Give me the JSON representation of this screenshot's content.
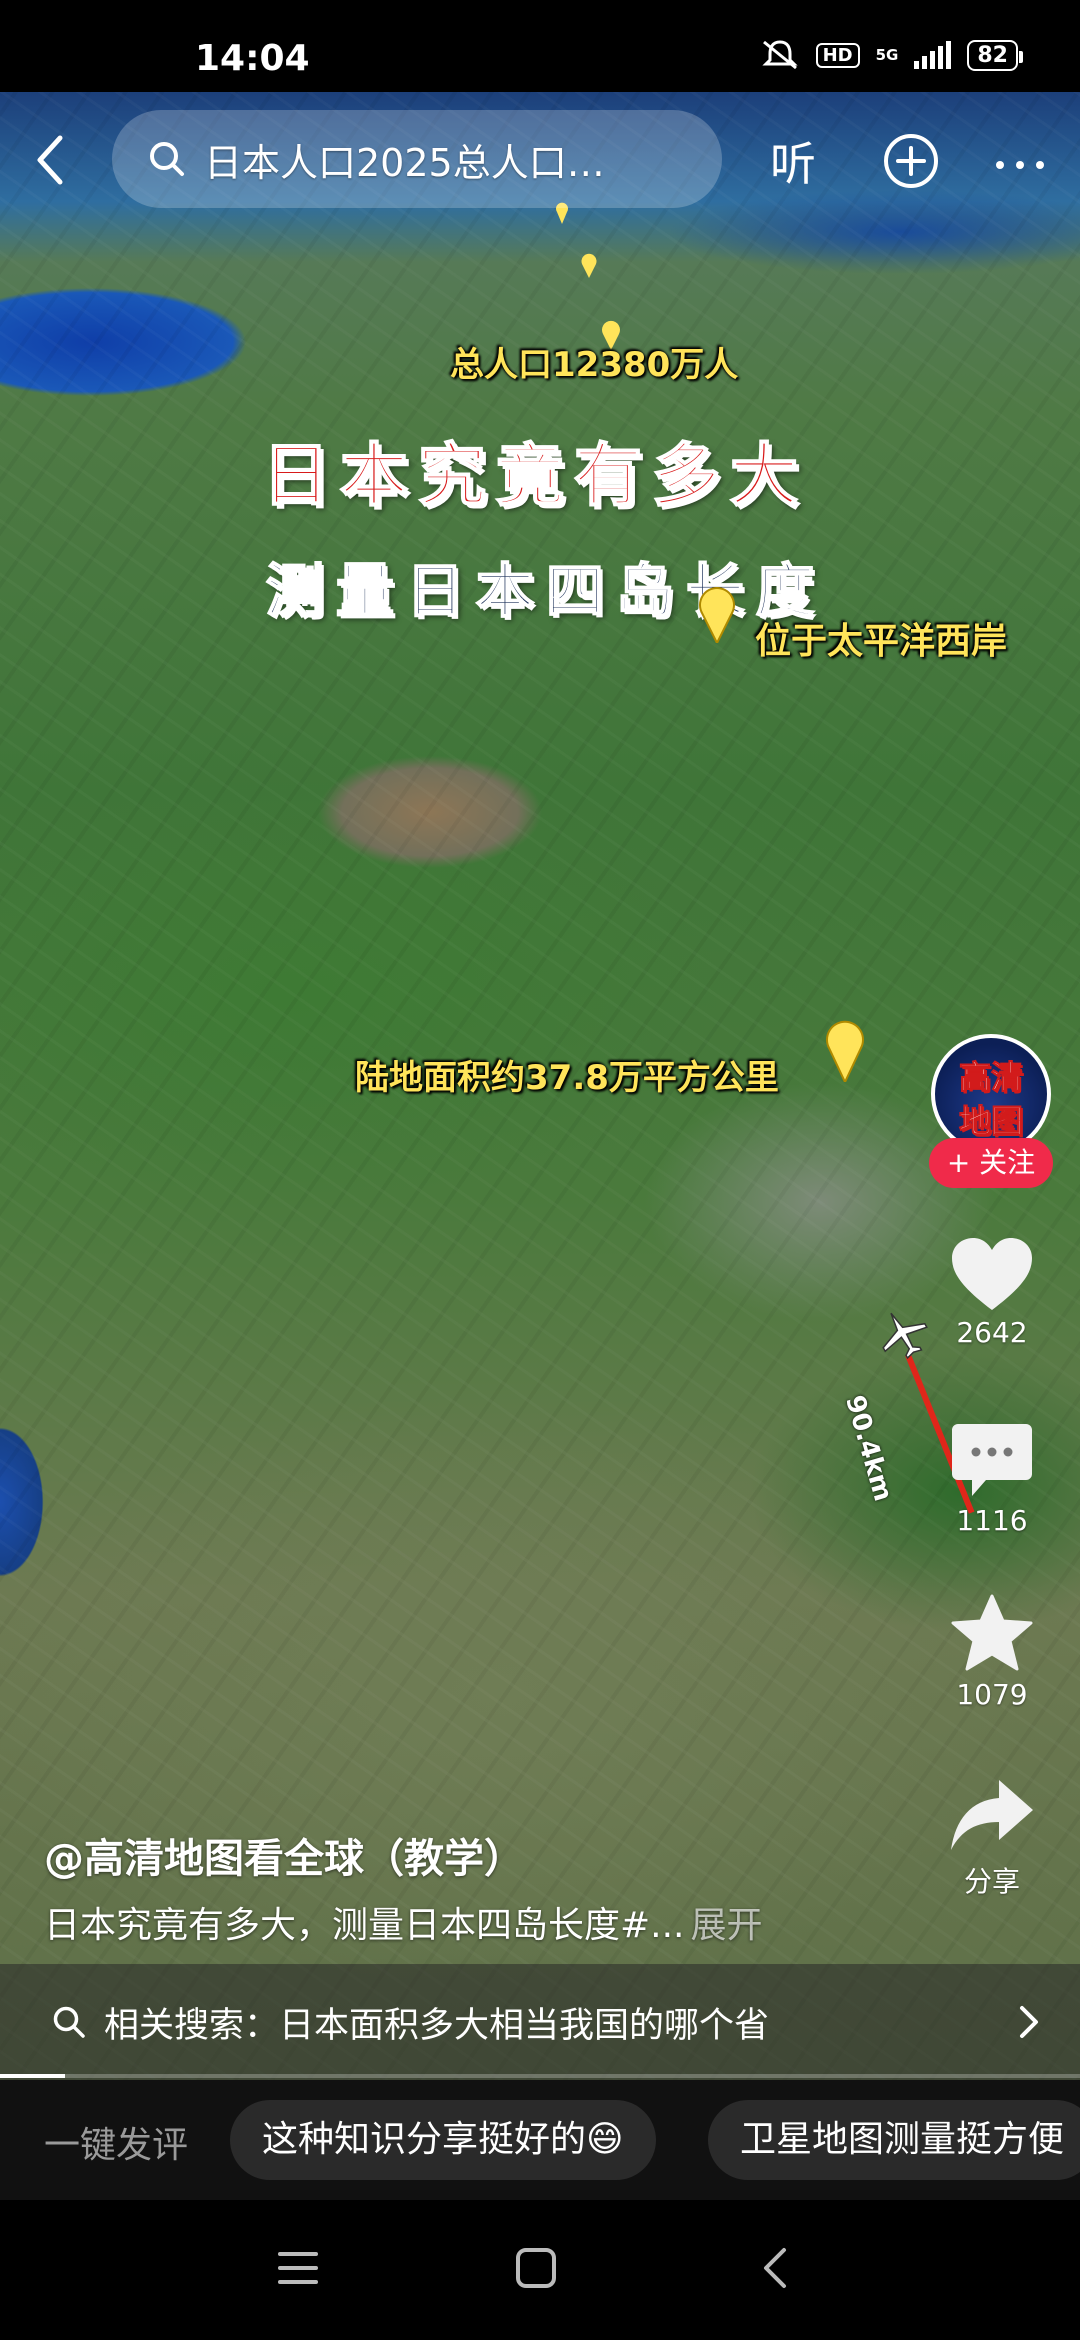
{
  "status_bar": {
    "time": "14:04",
    "network": "5G",
    "hd": "HD",
    "battery": "82"
  },
  "top_bar": {
    "search_query": "日本人口2025总人口…",
    "listen_label": "听"
  },
  "video": {
    "map_labels": {
      "population": "总人口12380万人",
      "title": "日本究竟有多大",
      "subtitle": "测量日本四岛长度",
      "location": "位于太平洋西岸",
      "area": "陆地面积约37.8万平方公里",
      "distance": "90.4km"
    },
    "author": "@高清地图看全球（教学）",
    "caption": "日本究竟有多大，测量日本四岛长度#...",
    "expand_label": "展开",
    "progress": 0.06
  },
  "actions": {
    "avatar_text": [
      "高清",
      "地图"
    ],
    "follow_label": "+ 关注",
    "likes": "2642",
    "comments": "1116",
    "favorites": "1079",
    "share_label": "分享"
  },
  "related_search": {
    "text": "相关搜索：日本面积多大相当我国的哪个省"
  },
  "comment_bar": {
    "label": "一键发评",
    "chips": [
      "这种知识分享挺好的😄",
      "卫星地图测量挺方便"
    ]
  },
  "colors": {
    "follow": "#f02a4a",
    "map_label": "#ffe45a",
    "title_red": "#d81a1a",
    "measure_line": "#e0261a"
  }
}
